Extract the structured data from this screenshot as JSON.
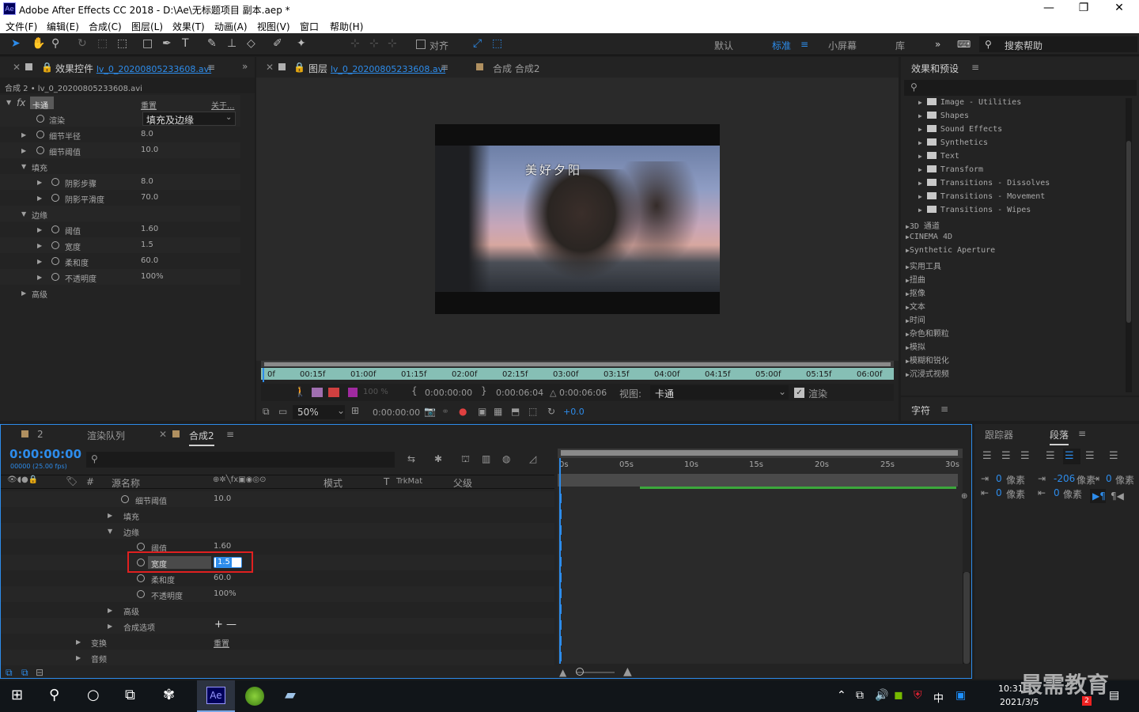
{
  "window": {
    "title": "Adobe After Effects CC 2018 - D:\\Ae\\无标题项目 副本.aep *",
    "app_icon": "Ae",
    "min": "—",
    "max": "❐",
    "close": "✕"
  },
  "menu": [
    "文件(F)",
    "编辑(E)",
    "合成(C)",
    "图层(L)",
    "效果(T)",
    "动画(A)",
    "视图(V)",
    "窗口",
    "帮助(H)"
  ],
  "toolbar": {
    "align_label": "对齐",
    "workspaces": [
      "默认",
      "标准",
      "小屏幕",
      "库"
    ],
    "active_workspace": "标准",
    "search_help": "搜索帮助"
  },
  "effects_panel": {
    "tab_label": "效果控件",
    "tab_file": "lv_0_20200805233608.avi",
    "breadcrumb": "合成 2 • lv_0_20200805233608.avi",
    "effect": {
      "fx": "fx",
      "name": "卡通",
      "reset": "重置",
      "about": "关于..."
    },
    "rows": [
      {
        "label": "渲染",
        "value": "填充及边缘"
      },
      {
        "label": "细节半径",
        "value": "8.0"
      },
      {
        "label": "细节阈值",
        "value": "10.0"
      },
      {
        "label": "填充",
        "value": ""
      },
      {
        "label": "阴影步骤",
        "value": "8.0"
      },
      {
        "label": "阴影平滑度",
        "value": "70.0"
      },
      {
        "label": "边缘",
        "value": ""
      },
      {
        "label": "阈值",
        "value": "1.60"
      },
      {
        "label": "宽度",
        "value": "1.5"
      },
      {
        "label": "柔和度",
        "value": "60.0"
      },
      {
        "label": "不透明度",
        "value": "100%"
      },
      {
        "label": "高级",
        "value": ""
      }
    ]
  },
  "viewer": {
    "layer_tab_prefix": "图层",
    "layer_tab_file": "lv_0_20200805233608.avi",
    "comp_tab": "合成 合成2",
    "overlay_text": "美好夕阳",
    "ruler": [
      "0f",
      "00:15f",
      "01:00f",
      "01:15f",
      "02:00f",
      "02:15f",
      "03:00f",
      "03:15f",
      "04:00f",
      "04:15f",
      "05:00f",
      "05:15f",
      "06:00f"
    ],
    "in_time": "0:00:00:00",
    "out_time": "0:00:06:04",
    "duration": "△ 0:00:06:06",
    "view_label": "视图:",
    "view_value": "卡通",
    "render_label": "渲染",
    "opacity": "100 %",
    "zoom": "50%",
    "current_time": "0:00:00:00",
    "exposure": "+0.0"
  },
  "effects_presets": {
    "title": "效果和预设",
    "items": [
      "Image - Utilities",
      "Shapes",
      "Sound Effects",
      "Synthetics",
      "Text",
      "Transform",
      "Transitions - Dissolves",
      "Transitions - Movement",
      "Transitions - Wipes"
    ],
    "categories": [
      "3D 通道",
      "CINEMA 4D",
      "Synthetic Aperture",
      "实用工具",
      "扭曲",
      "抠像",
      "文本",
      "时间",
      "杂色和颗粒",
      "模拟",
      "模糊和锐化",
      "沉浸式视频"
    ]
  },
  "char_panel": {
    "title": "字符"
  },
  "timeline": {
    "tabs": [
      "2",
      "渲染队列",
      "合成2"
    ],
    "time": "0:00:00:00",
    "fps": "00000 (25.00 fps)",
    "cols": {
      "source": "源名称",
      "mode": "模式",
      "t": "T",
      "trkmat": "TrkMat",
      "parent": "父级",
      "hash": "#"
    },
    "rows": [
      {
        "label": "细节阈值",
        "value": "10.0"
      },
      {
        "label": "填充",
        "value": ""
      },
      {
        "label": "边缘",
        "value": ""
      },
      {
        "label": "阈值",
        "value": "1.60"
      },
      {
        "label": "宽度",
        "value": "1.5"
      },
      {
        "label": "柔和度",
        "value": "60.0"
      },
      {
        "label": "不透明度",
        "value": "100%"
      },
      {
        "label": "高级",
        "value": ""
      },
      {
        "label": "合成选项",
        "value": "+ —"
      },
      {
        "label": "变换",
        "value": "重置"
      },
      {
        "label": "音频",
        "value": ""
      }
    ],
    "ruler": [
      "0s",
      "05s",
      "10s",
      "15s",
      "20s",
      "25s",
      "30s"
    ]
  },
  "right_panel": {
    "tabs": [
      "跟踪器",
      "段落"
    ],
    "indents": [
      {
        "v": "0",
        "u": "像素"
      },
      {
        "v": "-206",
        "u": "像素"
      },
      {
        "v": "0",
        "u": "像素"
      },
      {
        "v": "0",
        "u": "像素"
      },
      {
        "v": "0",
        "u": "像素"
      }
    ]
  },
  "taskbar": {
    "time": "10:31",
    "date": "2021/3/5",
    "ime": "中",
    "badge": "2",
    "watermark": "最需教育",
    "ae": "Ae"
  }
}
